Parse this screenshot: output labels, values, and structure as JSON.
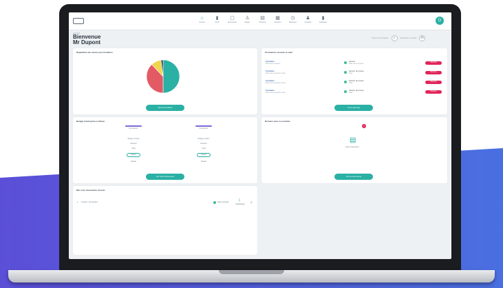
{
  "colors": {
    "teal": "#2ab0a4",
    "red": "#e35a64",
    "yellow": "#f2d44a",
    "navy": "#2c3e67",
    "pink": "#e0265a",
    "purple": "#5b4fd8"
  },
  "header": {
    "breadcrumb": "Accueil",
    "welcome_line1": "Bienvenue",
    "welcome_line2": "Mr Dupont",
    "action_left": "Trouver une formation",
    "action_right": "Demander un conseil",
    "avatar_initial": "D"
  },
  "nav": [
    {
      "icon": "home-icon",
      "glyph": "⌂",
      "label": "Accueil"
    },
    {
      "icon": "user-icon",
      "glyph": "▮",
      "label": "Profil"
    },
    {
      "icon": "document-icon",
      "glyph": "▢",
      "label": "Documents"
    },
    {
      "icon": "person-icon",
      "glyph": "♙",
      "label": "Equipe"
    },
    {
      "icon": "calendar-icon",
      "glyph": "▤",
      "label": "Planning"
    },
    {
      "icon": "folder-icon",
      "glyph": "▦",
      "label": "Dossiers"
    },
    {
      "icon": "clock-icon",
      "glyph": "◷",
      "label": "Historique"
    },
    {
      "icon": "group-icon",
      "glyph": "♟",
      "label": "Contacts"
    },
    {
      "icon": "book-icon",
      "glyph": "▮",
      "label": "Catalogue"
    }
  ],
  "pie_card": {
    "title": "Répartition des heures par formation",
    "legend": [
      {
        "label": "non commencé",
        "color": "#2ab0a4"
      },
      {
        "label": "en retard",
        "color": "#e35a64"
      },
      {
        "label": "en cours/terminé",
        "color": "#f2d44a"
      },
      {
        "label": "validé",
        "color": "#2c3e67"
      }
    ],
    "button": "Voir les formations"
  },
  "chart_data": {
    "type": "pie",
    "categories": [
      "non commencé",
      "en retard",
      "en cours/terminé",
      "validé"
    ],
    "values": [
      50,
      38,
      10,
      2
    ]
  },
  "upcoming_card": {
    "title": "Prochaines sessions à venir",
    "left_items": [
      {
        "title": "Formation",
        "sub": "Date de la session"
      },
      {
        "title": "Formation",
        "sub": "Date de la session et lieu"
      },
      {
        "title": "Formation",
        "sub": "Date de la session et lieu"
      },
      {
        "title": "Formation",
        "sub": "Date de la session et lieu"
      }
    ],
    "right_items": [
      {
        "title": "Session",
        "sub": "Date de la session",
        "badge": "S'inscrire"
      },
      {
        "title": "Session de groupe",
        "sub": "Date",
        "badge": "S'inscrire"
      },
      {
        "title": "Session de groupe",
        "sub": "Date",
        "badge": "S'inscrire"
      },
      {
        "title": "Session de groupe",
        "sub": "Date",
        "badge": "S'inscrire"
      }
    ],
    "button": "Voir le planning"
  },
  "budget_card": {
    "title": "Budget d'entreprise à utiliser",
    "col_a": {
      "head": "Formations",
      "lines": [
        "Budget restant",
        "Montant",
        "Total"
      ],
      "pill": "Utiliser",
      "link": "Détails"
    },
    "col_b": {
      "head": "Formations",
      "lines": [
        "Budget restant",
        "Montant",
        "Total"
      ],
      "pill": "Utiliser",
      "link": "Détails"
    },
    "button": "Voir mes financements"
  },
  "docs_card": {
    "title": "Derniers docs à consulter",
    "notif": "1",
    "empty_text": "Aucun document",
    "button": "Voir les documents"
  },
  "recent_card": {
    "title": "Mes trois documents récents",
    "item": "Contrat - Convention",
    "meta": "Date de dépôt",
    "action": "Télécharger"
  }
}
